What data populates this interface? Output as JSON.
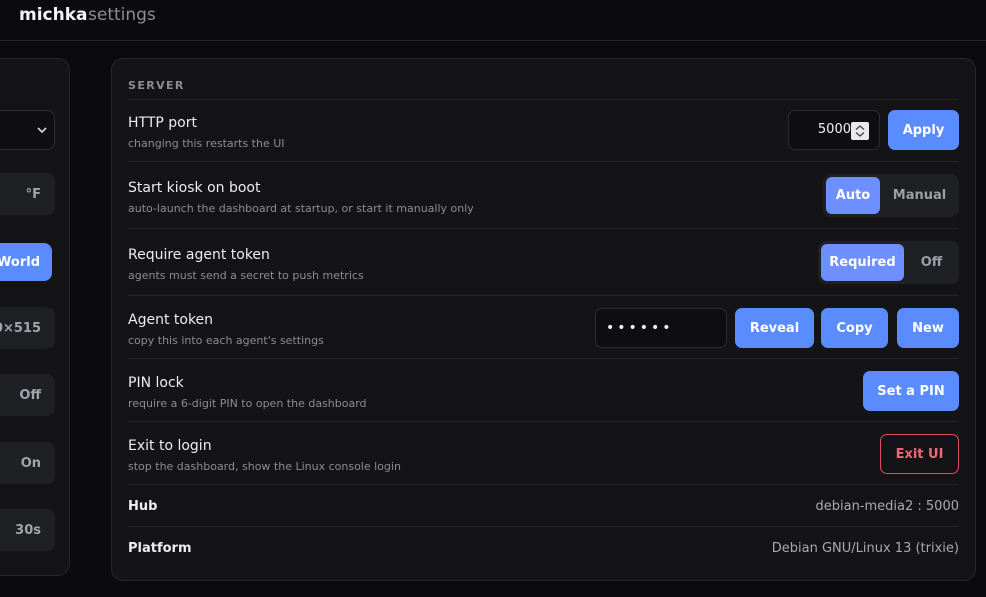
{
  "topbar": {
    "brand": "michka",
    "subtitle": "settings"
  },
  "left_panel": {
    "controls": [
      "°F",
      "World",
      "0×515",
      "Off",
      "On",
      "30s"
    ]
  },
  "server": {
    "section_label": "SERVER",
    "http_port": {
      "title": "HTTP port",
      "desc": "changing this restarts the UI",
      "value": "5000",
      "apply_label": "Apply"
    },
    "kiosk": {
      "title": "Start kiosk on boot",
      "desc": "auto-launch the dashboard at startup, or start it manually only",
      "options": [
        "Auto",
        "Manual"
      ],
      "selected": "Auto"
    },
    "agent_token_req": {
      "title": "Require agent token",
      "desc": "agents must send a secret to push metrics",
      "options": [
        "Required",
        "Off"
      ],
      "selected": "Required"
    },
    "agent_token": {
      "title": "Agent token",
      "desc": "copy this into each agent's settings",
      "masked_value": "••••••",
      "reveal_label": "Reveal",
      "copy_label": "Copy",
      "new_label": "New"
    },
    "pin_lock": {
      "title": "PIN lock",
      "desc": "require a 6-digit PIN to open the dashboard",
      "button_label": "Set a PIN"
    },
    "exit": {
      "title": "Exit to login",
      "desc": "stop the dashboard, show the Linux console login",
      "button_label": "Exit UI"
    },
    "hub": {
      "label": "Hub",
      "value": "debian-media2 : 5000"
    },
    "platform": {
      "label": "Platform",
      "value": "Debian GNU/Linux 13 (trixie)"
    }
  },
  "colors": {
    "accent": "#5b8cff",
    "segment_active": "#6e8fff",
    "danger": "#e24c5e",
    "background": "#0b0b0d",
    "panel": "#141417"
  }
}
